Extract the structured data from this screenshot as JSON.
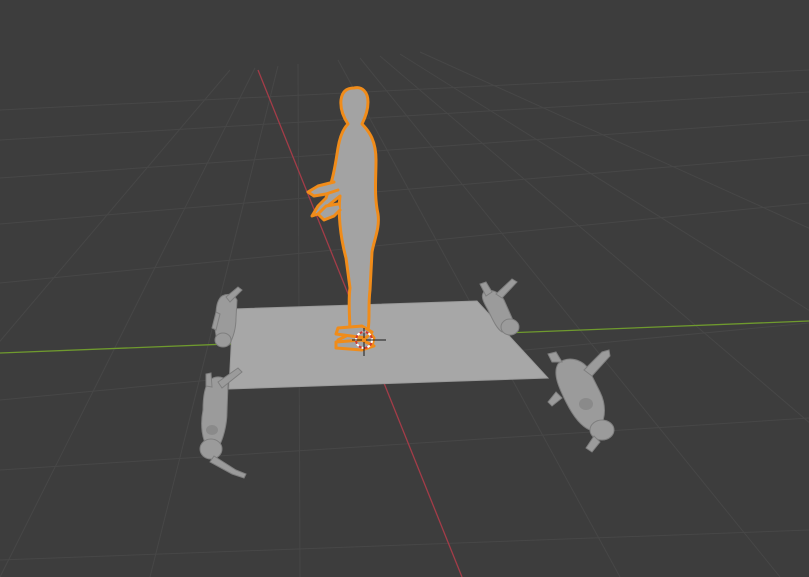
{
  "viewport": {
    "mode": "3D Viewport",
    "background_color": "#3d3d3d",
    "grid_color": "#474747",
    "x_axis_color": "#a33c48",
    "y_axis_color": "#6f9a2e",
    "selection_color": "#f08c1a",
    "plane_color": "#a7a7a7"
  },
  "objects": {
    "standing_figure": {
      "name": "human-figure-standing",
      "selected": true
    },
    "plane": {
      "name": "ground-plane",
      "selected": false
    },
    "lying_figures": [
      {
        "name": "human-figure-lying-left-top"
      },
      {
        "name": "human-figure-lying-left-bottom"
      },
      {
        "name": "human-figure-lying-right-top"
      },
      {
        "name": "human-figure-lying-right-bottom"
      }
    ]
  },
  "icons": {
    "cursor": "3d-cursor-icon",
    "origin": "object-origin-icon"
  }
}
